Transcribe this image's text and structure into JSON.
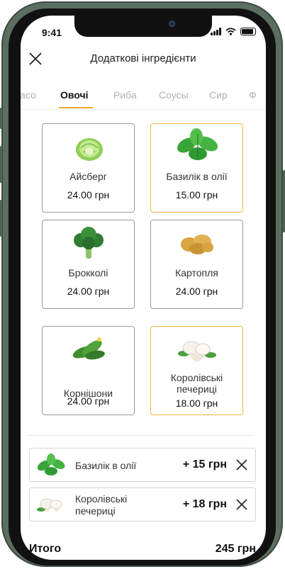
{
  "status": {
    "time": "9:41"
  },
  "header": {
    "title": "Додаткові інгредієнти"
  },
  "tabs": [
    "асо",
    "Овочі",
    "Риба",
    "Соусы",
    "Сир",
    "Ф"
  ],
  "active_tab": "Овочі",
  "colors": {
    "accent": "#f5a623",
    "frame": "#5b6e5f"
  },
  "items": [
    {
      "name": "Айсберг",
      "price": "24.00 грн",
      "selected": false,
      "icon": "lettuce-icon"
    },
    {
      "name": "Базилік в олії",
      "price": "15.00 грн",
      "selected": true,
      "icon": "basil-icon"
    },
    {
      "name": "Брокколі",
      "price": "24.00 грн",
      "selected": false,
      "icon": "broccoli-icon"
    },
    {
      "name": "Картопля",
      "price": "24.00 грн",
      "selected": false,
      "icon": "potato-icon"
    },
    {
      "name": "Корнішони",
      "price": "24.00 грн",
      "selected": false,
      "icon": "cucumber-icon"
    },
    {
      "name_line1": "Королівські",
      "name_line2": "печериці",
      "price": "18.00 грн",
      "selected": true,
      "icon": "mushroom-icon"
    }
  ],
  "selected": [
    {
      "name": "Базилік в олії",
      "price": "+ 15 грн",
      "icon": "basil-icon"
    },
    {
      "name_line1": "Королівські",
      "name_line2": "печериці",
      "price": "+ 18 грн",
      "icon": "mushroom-icon"
    }
  ],
  "total": {
    "label": "Итого",
    "value": "245 грн"
  }
}
